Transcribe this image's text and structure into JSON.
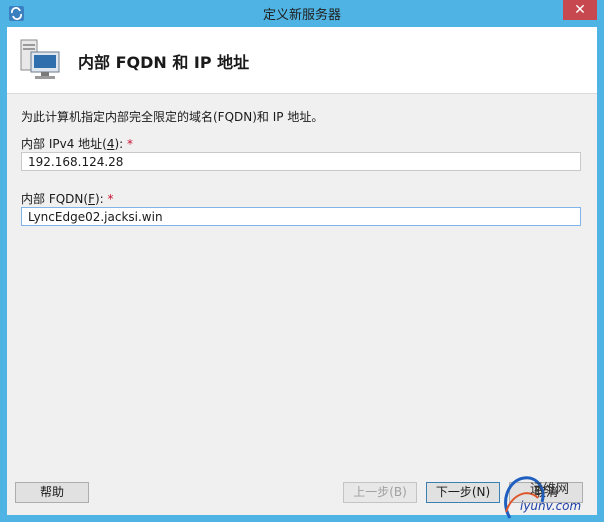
{
  "window": {
    "title": "定义新服务器",
    "close_glyph": "✕"
  },
  "header": {
    "title": "内部 FQDN 和 IP 地址",
    "icon": "server-computer-icon"
  },
  "description": "为此计算机指定内部完全限定的域名(FQDN)和 IP 地址。",
  "ipv4": {
    "label_prefix": "内部 IPv4 地址(",
    "label_key": "4",
    "label_suffix": "):",
    "required_mark": "*",
    "value": "192.168.124.28"
  },
  "fqdn": {
    "label_prefix": "内部 FQDN(",
    "label_key": "F",
    "label_suffix": "):",
    "required_mark": "*",
    "value": "LyncEdge02.jacksi.win"
  },
  "buttons": {
    "help": "帮助",
    "back": "上一步(B)",
    "next": "下一步(N)",
    "cancel": "取消"
  },
  "watermark": {
    "text": "运维网",
    "sub": "iyunv.com"
  }
}
